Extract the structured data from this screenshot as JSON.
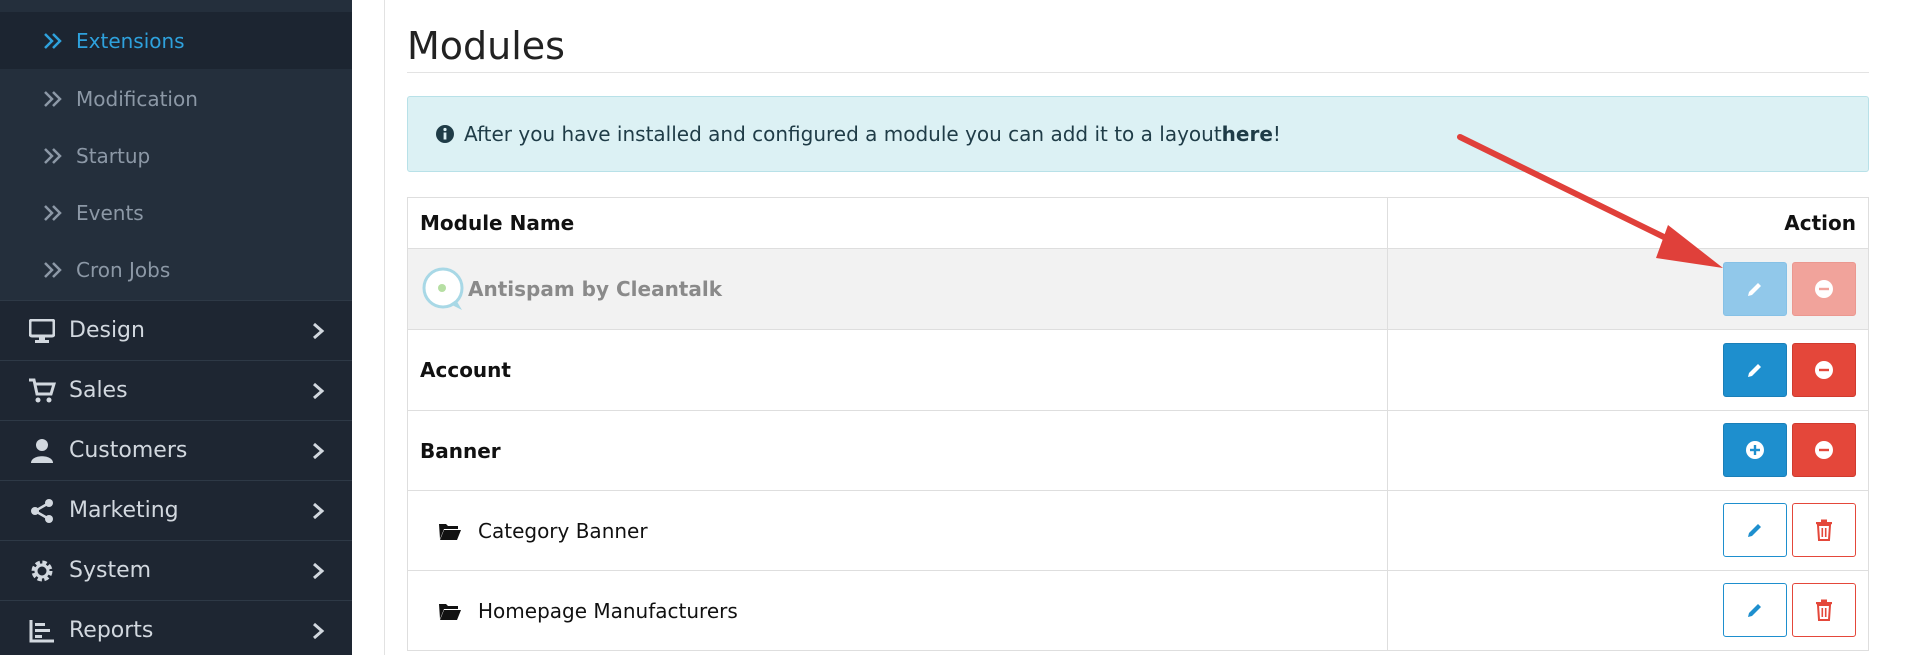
{
  "sidebar": {
    "sub_items": [
      {
        "label": "Extensions",
        "active": true
      },
      {
        "label": "Modification"
      },
      {
        "label": "Startup"
      },
      {
        "label": "Events"
      },
      {
        "label": "Cron Jobs"
      }
    ],
    "main_items": [
      {
        "label": "Design",
        "icon": "desktop-icon"
      },
      {
        "label": "Sales",
        "icon": "cart-icon"
      },
      {
        "label": "Customers",
        "icon": "user-icon"
      },
      {
        "label": "Marketing",
        "icon": "share-icon"
      },
      {
        "label": "System",
        "icon": "gear-icon"
      },
      {
        "label": "Reports",
        "icon": "bar-chart-icon"
      }
    ]
  },
  "page": {
    "title": "Modules",
    "alert": {
      "text_before": "After you have installed and configured a module you can add it to a layout ",
      "link_text": "here",
      "text_after": "!"
    }
  },
  "table": {
    "headers": {
      "name": "Module Name",
      "action": "Action"
    },
    "rows": [
      {
        "name": "Antispam by Cleantalk",
        "type": "installed-disabled"
      },
      {
        "name": "Account",
        "type": "installed"
      },
      {
        "name": "Banner",
        "type": "not-installed"
      },
      {
        "name": "Category Banner",
        "type": "instance"
      },
      {
        "name": "Homepage Manufacturers",
        "type": "instance"
      }
    ]
  },
  "colors": {
    "sidebar_bg": "#1e2632",
    "accent_blue": "#1e8fce",
    "danger_red": "#e4473a",
    "annotation_red": "#e0403a"
  }
}
